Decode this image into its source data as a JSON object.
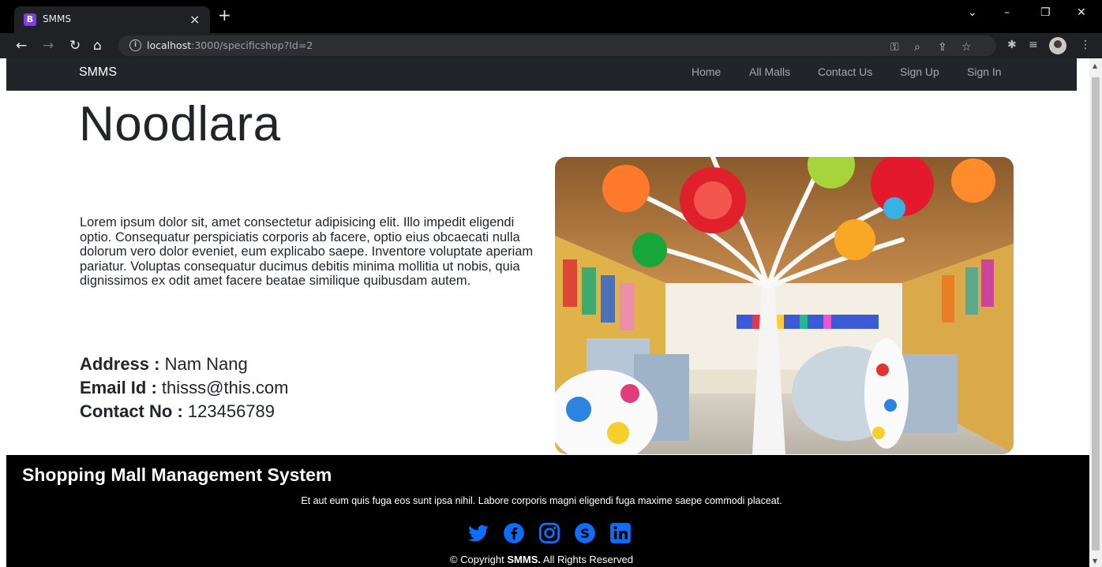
{
  "browser": {
    "tab_favicon": "B",
    "tab_title": "SMMS",
    "tab_close": "×",
    "new_tab": "+",
    "url_host": "localhost",
    "url_rest": ":3000/specificshop?Id=2"
  },
  "navbar": {
    "brand": "SMMS",
    "links": [
      "Home",
      "All Malls",
      "Contact Us",
      "Sign Up",
      "Sign In"
    ]
  },
  "shop": {
    "title": "Noodlara",
    "description": "Lorem ipsum dolor sit, amet consectetur adipisicing elit. Illo impedit eligendi optio. Consequatur perspiciatis corporis ab facere, optio eius obcaecati nulla dolorum vero dolor eveniet, eum explicabo saepe. Inventore voluptate aperiam pariatur. Voluptas consequatur ducimus debitis minima mollitia ut nobis, quia dignissimos ex odit amet facere beatae similique quibusdam autem.",
    "address_label": "Address :",
    "address_value": "Nam Nang",
    "email_label": "Email Id :",
    "email_value": "thisss@this.com",
    "contact_label": "Contact No :",
    "contact_value": "123456789"
  },
  "footer": {
    "title": "Shopping Mall Management System",
    "text": "Et aut eum quis fuga eos sunt ipsa nihil. Labore corporis magni eligendi fuga maxime saepe commodi placeat.",
    "socials": [
      "twitter-icon",
      "facebook-icon",
      "instagram-icon",
      "skype-icon",
      "linkedin-icon"
    ],
    "copyright_prefix": "© Copyright",
    "copyright_brand": "SMMS.",
    "copyright_suffix": "All Rights Reserved"
  },
  "colors": {
    "navbar_bg": "#212529",
    "footer_bg": "#000000",
    "social_blue": "#0d6efd"
  }
}
